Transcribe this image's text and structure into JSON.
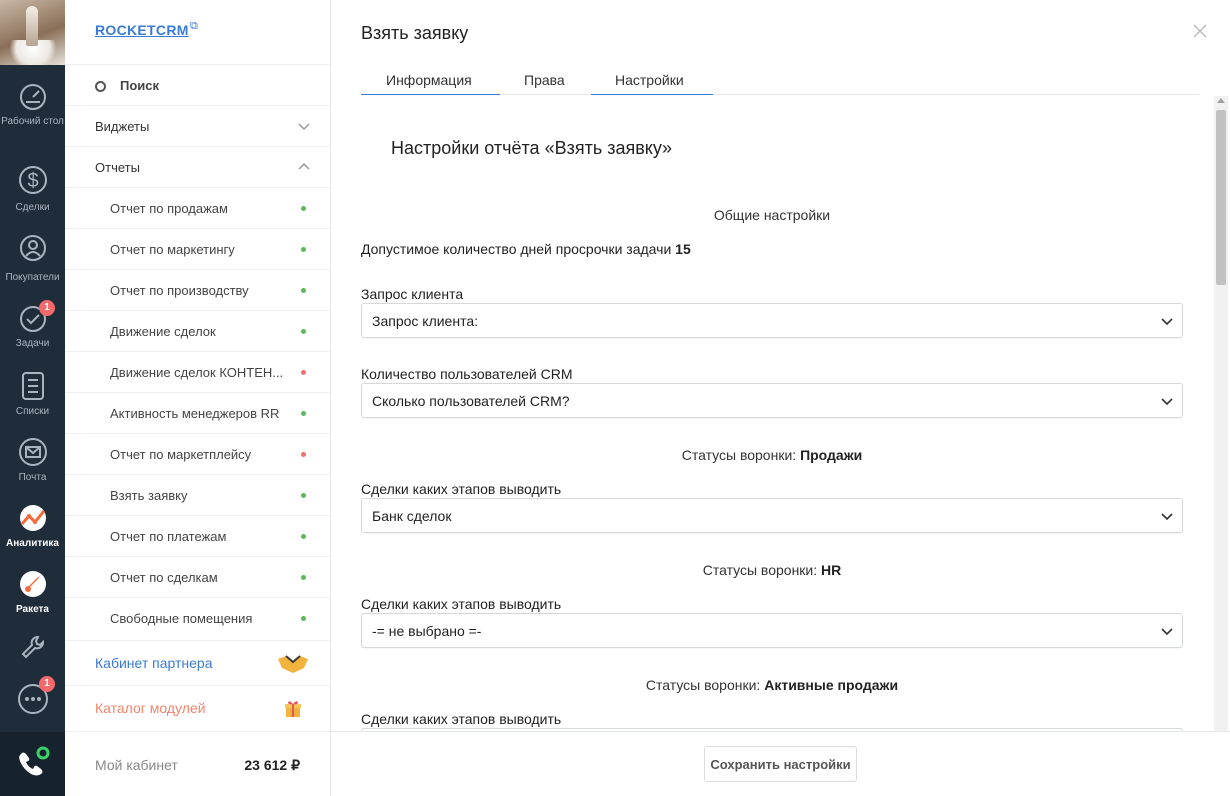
{
  "rail": {
    "items": [
      {
        "label": "Рабочий стол",
        "icon": "dashboard-icon",
        "active": false
      },
      {
        "label": "Сделки",
        "icon": "dollar-icon",
        "active": false
      },
      {
        "label": "Покупатели",
        "icon": "customers-icon",
        "active": false
      },
      {
        "label": "Задачи",
        "icon": "check-icon",
        "active": false,
        "badge": "1"
      },
      {
        "label": "Списки",
        "icon": "list-icon",
        "active": false
      },
      {
        "label": "Почта",
        "icon": "mail-icon",
        "active": false
      },
      {
        "label": "Аналитика",
        "icon": "analytics-icon",
        "active": true
      },
      {
        "label": "Ракета",
        "icon": "rocket-icon",
        "active": true
      }
    ],
    "chat_badge": "1",
    "colors": {
      "bg": "#1f2d3b",
      "accent": "#f46a3c",
      "badge": "#f46a6a",
      "phone_status": "#3ad36a"
    }
  },
  "menu": {
    "brand": "ROCKETCRM",
    "search_label": "Поиск",
    "widgets_label": "Виджеты",
    "reports_label": "Отчеты",
    "reports": [
      {
        "label": "Отчет по продажам",
        "status": "green"
      },
      {
        "label": "Отчет по маркетингу",
        "status": "green"
      },
      {
        "label": "Отчет по производству",
        "status": "green"
      },
      {
        "label": "Движение сделок",
        "status": "green"
      },
      {
        "label": "Движение сделок КОНТЕН...",
        "status": "red"
      },
      {
        "label": "Активность менеджеров RR",
        "status": "green"
      },
      {
        "label": "Отчет по маркетплейсу",
        "status": "red"
      },
      {
        "label": "Взять заявку",
        "status": "green"
      },
      {
        "label": "Отчет по платежам",
        "status": "green"
      },
      {
        "label": "Отчет по сделкам",
        "status": "green"
      },
      {
        "label": "Свободные помещения",
        "status": "green"
      }
    ],
    "partner_label": "Кабинет партнера",
    "catalog_label": "Каталог модулей",
    "cabinet_label": "Мой кабинет",
    "cabinet_amount": "23 612 ₽",
    "colors": {
      "link": "#3a7bd5",
      "catalog": "#f0846a",
      "green": "#5cb85c",
      "red": "#f07070"
    }
  },
  "panel": {
    "title": "Взять заявку",
    "tabs": [
      "Информация",
      "Права",
      "Настройки"
    ],
    "report_title": "Настройки отчёта «Взять заявку»",
    "general_heading": "Общие настройки",
    "overdue_text": "Допустимое количество дней просрочки задачи",
    "overdue_value": "15",
    "fields": [
      {
        "label": "Запрос клиента",
        "value": "Запрос клиента:"
      },
      {
        "label": "Количество пользователей CRM",
        "value": "Сколько пользователей CRM?"
      }
    ],
    "funnels": [
      {
        "prefix": "Статусы воронки:",
        "name": "Продажи",
        "field_label": "Сделки каких этапов выводить",
        "value": "Банк сделок"
      },
      {
        "prefix": "Статусы воронки:",
        "name": "HR",
        "field_label": "Сделки каких этапов выводить",
        "value": "-= не выбрано =-"
      },
      {
        "prefix": "Статусы воронки:",
        "name": "Активные продажи",
        "field_label": "Сделки каких этапов выводить",
        "value": ""
      }
    ],
    "save_label": "Сохранить настройки"
  }
}
